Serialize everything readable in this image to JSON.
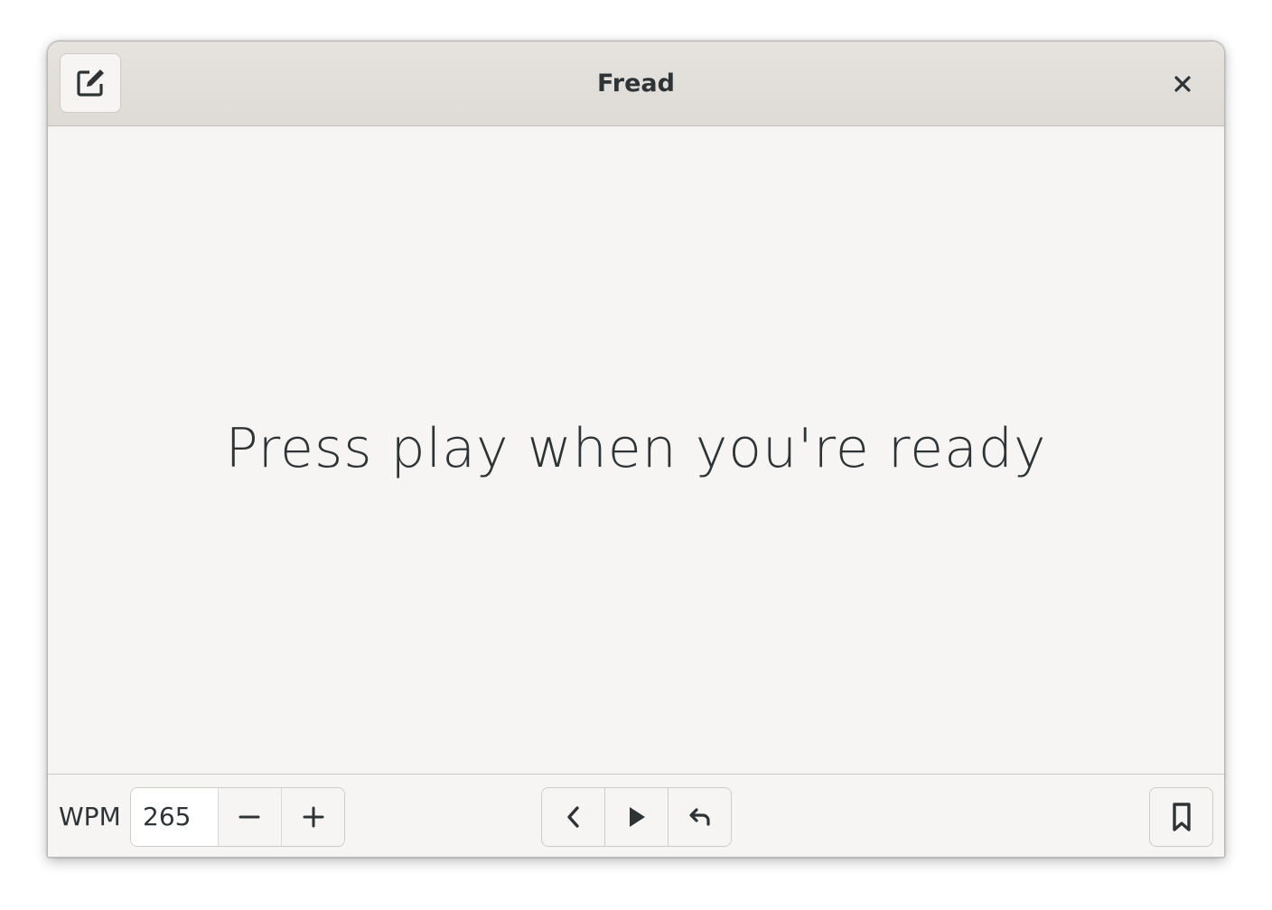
{
  "window": {
    "title": "Fread"
  },
  "header": {
    "edit_icon": "edit-document-icon",
    "close_icon": "close-icon"
  },
  "main": {
    "message": "Press play when you're ready"
  },
  "footer": {
    "wpm_label": "WPM",
    "wpm_value": "265",
    "decrease_icon": "minus-icon",
    "increase_icon": "plus-icon",
    "previous_icon": "chevron-left-icon",
    "play_icon": "play-icon",
    "restart_icon": "undo-arrow-icon",
    "bookmark_icon": "bookmark-icon"
  },
  "colors": {
    "text": "#2e3436",
    "background": "#f6f5f4",
    "headerbar": "#e1deda"
  }
}
